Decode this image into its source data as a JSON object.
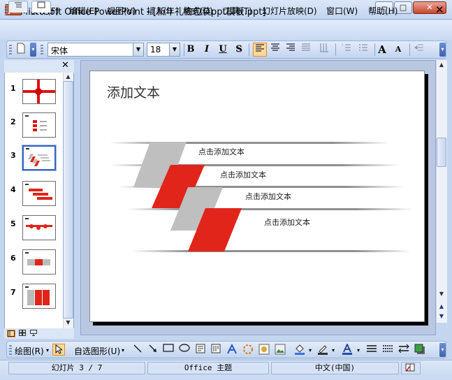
{
  "window": {
    "title": "Microsoft Office PowerPoint - [新年礼物包装ppt模板.ppt]",
    "min_glyph": "─",
    "max_glyph": "□",
    "close_glyph": "✕"
  },
  "menu": {
    "items": [
      "文件(F)",
      "编辑(E)",
      "视图(V)",
      "插入(I)",
      "格式(O)",
      "工具(T)",
      "幻灯片放映(D)",
      "窗口(W)",
      "帮助(H)"
    ],
    "close_glyph": "✕"
  },
  "toolbar": {
    "font_name": "宋体",
    "font_size": "18",
    "bold": "B",
    "italic": "I",
    "underline": "U",
    "shadow": "S",
    "grow_font": "A",
    "shrink_font": "A"
  },
  "slides_pane": {
    "numbers": [
      "1",
      "2",
      "3",
      "4",
      "5",
      "6",
      "7"
    ],
    "selected": 3,
    "close_glyph": "✕"
  },
  "slide": {
    "title": "添加文本",
    "labels": [
      "点击添加文本",
      "点击添加文本",
      "点击添加文本",
      "点击添加文本"
    ],
    "colors": {
      "red": "#e1251b",
      "gray": "#bfbfbf"
    }
  },
  "draw_toolbar": {
    "draw_label": "绘图(R)",
    "autoshapes_label": "自选图形(U)"
  },
  "status": {
    "slide_info": "幻灯片 3 / 7",
    "theme": "Office 主题",
    "language": "中文(中国)"
  }
}
